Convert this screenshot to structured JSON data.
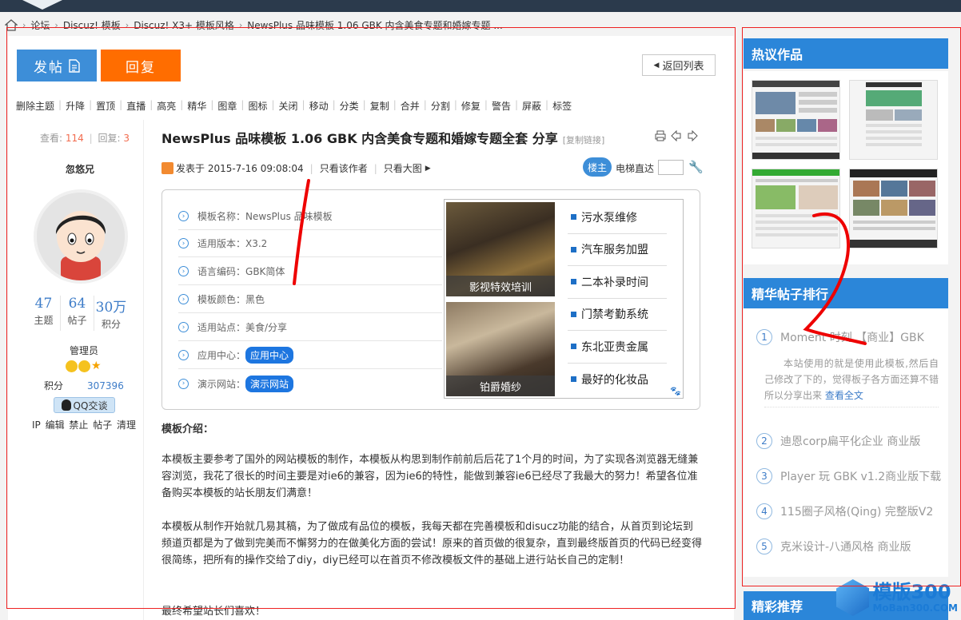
{
  "breadcrumb": [
    "论坛",
    "Discuz! 模板",
    "Discuz! X3+ 模板风格",
    "NewsPlus 品味模板 1.06 GBK 内含美食专题和婚嫁专题 ..."
  ],
  "toolbar": {
    "post_label": "发帖",
    "reply_label": "回复",
    "back_label": "返回列表"
  },
  "moderation": [
    "删除主题",
    "升降",
    "置顶",
    "直播",
    "高亮",
    "精华",
    "图章",
    "图标",
    "关闭",
    "移动",
    "分类",
    "复制",
    "合并",
    "分割",
    "修复",
    "警告",
    "屏蔽",
    "标签"
  ],
  "thread_stats": {
    "views_label": "查看:",
    "views": "114",
    "replies_label": "回复:",
    "replies": "3"
  },
  "author": {
    "name": "忽悠兄",
    "stats": [
      {
        "value": "47",
        "label": "主题"
      },
      {
        "value": "64",
        "label": "帖子"
      },
      {
        "value": "30万",
        "label": "积分"
      }
    ],
    "role": "管理员",
    "points_label": "积分",
    "points": "307396",
    "qq_label": "QQ交谈",
    "admin_links": "IP 编辑 禁止 帖子 清理"
  },
  "post": {
    "title": "NewsPlus 品味模板 1.06 GBK 内含美食专题和婚嫁专题全套 分享",
    "copy_link": "[复制链接]",
    "posted": "发表于 2015-7-16 09:08:04",
    "only_author": "只看该作者",
    "only_images": "只看大图",
    "floor": "楼主",
    "elevator": "电梯直达"
  },
  "info_rows": [
    {
      "label": "模板名称：",
      "value": "NewsPlus 品味模板"
    },
    {
      "label": "适用版本：",
      "value": "X3.2"
    },
    {
      "label": "语言编码：",
      "value": "GBK简体"
    },
    {
      "label": "模板颜色：",
      "value": "黑色"
    },
    {
      "label": "适用站点：",
      "value": "美食/分享"
    },
    {
      "label": "应用中心：",
      "value": "应用中心"
    },
    {
      "label": "演示网站：",
      "value": "演示网站"
    }
  ],
  "promo": {
    "images": [
      "影视特效培训",
      "铂爵婚纱"
    ],
    "links": [
      "污水泵维修",
      "汽车服务加盟",
      "二本补录时间",
      "门禁考勤系统",
      "东北亚贵金属",
      "最好的化妆品"
    ]
  },
  "intro": {
    "heading": "模板介绍：",
    "paragraphs": [
      "本模板主要参考了国外的网站模板的制作，本模板从构思到制作前前后后花了1个月的时间，为了实现各浏览器无缝兼容浏览，我花了很长的时间主要是对ie6的兼容，因为ie6的特性，能做到兼容ie6已经尽了我最大的努力！希望各位准备购买本模板的站长朋友们满意！",
      "本模板从制作开始就几易其稿，为了做成有品位的模板，我每天都在完善模板和disucz功能的结合，从首页到论坛到频道页都是为了做到完美而不懈努力的在做美化方面的尝试！原来的首页做的很复杂，直到最终版首页的代码已经变得很简练，把所有的操作交给了diy，diy已经可以在首页不修改模板文件的基础上进行站长自己的定制！",
      "最终希望站长们喜欢！"
    ]
  },
  "sidebar": {
    "hot_title": "热议作品",
    "rank_title": "精华帖子排行",
    "recommend_title": "精彩推荐",
    "rank": [
      {
        "num": "1",
        "title": "Moment 时刻 【商业】GBK"
      },
      {
        "num": "2",
        "title": "迪恩corp扁平化企业 商业版"
      },
      {
        "num": "3",
        "title": "Player 玩 GBK v1.2商业版下载"
      },
      {
        "num": "4",
        "title": "115圈子风格(Qing) 完整版V2"
      },
      {
        "num": "5",
        "title": "克米设计-八通风格 商业版"
      }
    ],
    "rank_desc": "本站使用的就是使用此模板,然后自己修改了下的，觉得板子各方面还算不错所以分享出来",
    "rank_more": "查看全文"
  },
  "watermark": {
    "brand": "模版300",
    "url": "MoBan300.COM"
  },
  "colors": {
    "accent": "#2b86d9",
    "reply": "#ff6d00",
    "annotation": "#ee0000"
  }
}
